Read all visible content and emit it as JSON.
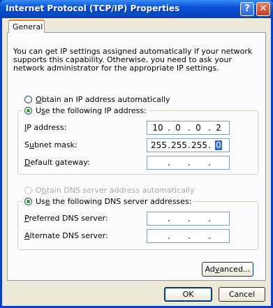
{
  "window": {
    "title": "Internet Protocol (TCP/IP) Properties",
    "help_glyph": "?",
    "close_glyph": "✕"
  },
  "tabs": [
    {
      "label": "General"
    }
  ],
  "intro_text": "You can get IP settings assigned automatically if your network supports this capability. Otherwise, you need to ask your network administrator for the appropriate IP settings.",
  "ip_section": {
    "auto_option": {
      "prefix": "",
      "mnemonic": "O",
      "rest": "btain an IP address automatically",
      "checked": false
    },
    "manual_option": {
      "prefix": "U",
      "mnemonic": "s",
      "rest": "e the following IP address:",
      "checked": true
    },
    "fields": [
      {
        "label_prefix": "",
        "mnemonic": "I",
        "label_rest": "P address:",
        "octets": [
          "10",
          "0",
          "0",
          "2"
        ]
      },
      {
        "label_prefix": "S",
        "mnemonic": "u",
        "label_rest": "bnet mask:",
        "octets": [
          "255",
          "255",
          "255",
          "0"
        ]
      },
      {
        "label_prefix": "",
        "mnemonic": "D",
        "label_rest": "efault gateway:",
        "octets": [
          "",
          "",
          "",
          ""
        ]
      }
    ]
  },
  "dns_section": {
    "auto_option": {
      "prefix": "O",
      "mnemonic": "b",
      "rest": "tain DNS server address automatically",
      "checked": false,
      "disabled": true
    },
    "manual_option": {
      "prefix": "Us",
      "mnemonic": "e",
      "rest": " the following DNS server addresses:",
      "checked": true
    },
    "fields": [
      {
        "label_prefix": "",
        "mnemonic": "P",
        "label_rest": "referred DNS server:",
        "octets": [
          "",
          "",
          "",
          ""
        ]
      },
      {
        "label_prefix": "",
        "mnemonic": "A",
        "label_rest": "lternate DNS server:",
        "octets": [
          "",
          "",
          "",
          ""
        ]
      }
    ]
  },
  "buttons": {
    "advanced": {
      "prefix": "Ad",
      "mnemonic": "v",
      "rest": "anced..."
    },
    "ok": "OK",
    "cancel": "Cancel"
  },
  "dot": "."
}
